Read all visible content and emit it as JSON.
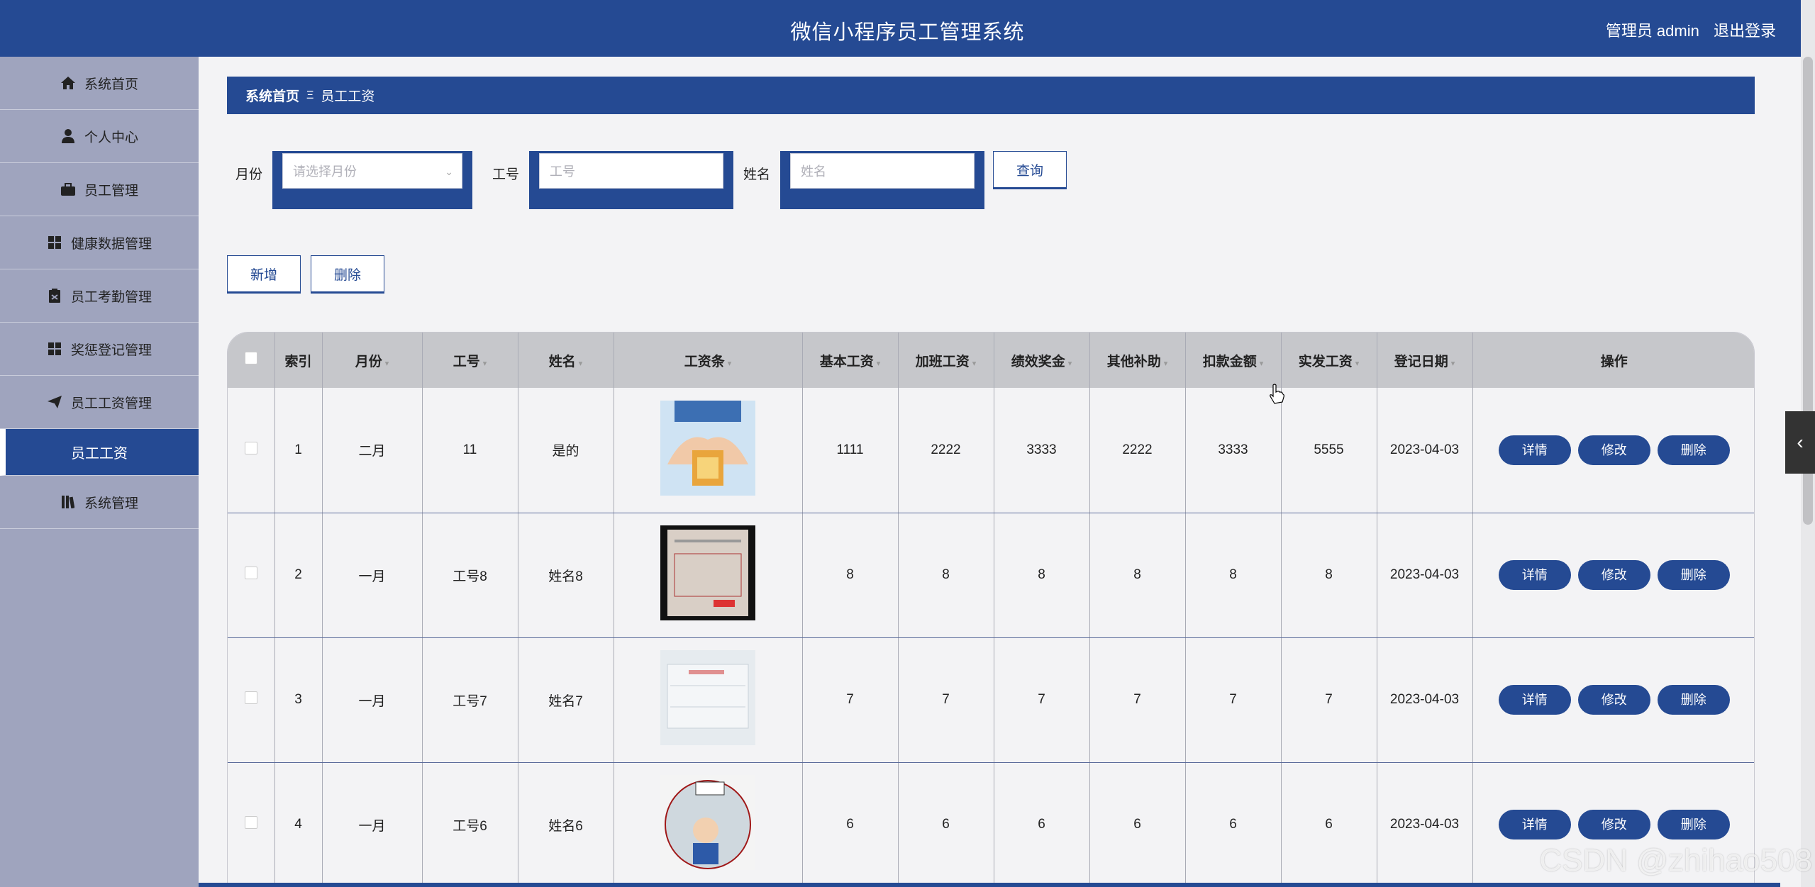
{
  "header": {
    "title": "微信小程序员工管理系统",
    "user_label": "管理员 admin",
    "logout": "退出登录"
  },
  "sidebar": {
    "items": [
      {
        "label": "系统首页",
        "icon": "home-icon"
      },
      {
        "label": "个人中心",
        "icon": "user-icon"
      },
      {
        "label": "员工管理",
        "icon": "briefcase-icon"
      },
      {
        "label": "健康数据管理",
        "icon": "grid-icon"
      },
      {
        "label": "员工考勤管理",
        "icon": "clipboard-icon"
      },
      {
        "label": "奖惩登记管理",
        "icon": "grid-icon"
      },
      {
        "label": "员工工资管理",
        "icon": "send-icon"
      },
      {
        "label": "员工工资",
        "icon": ""
      },
      {
        "label": "系统管理",
        "icon": "library-icon"
      }
    ]
  },
  "breadcrumb": {
    "home": "系统首页",
    "separator": "Ξ",
    "current": "员工工资"
  },
  "search": {
    "month_label": "月份",
    "month_placeholder": "请选择月份",
    "id_label": "工号",
    "id_placeholder": "工号",
    "name_label": "姓名",
    "name_placeholder": "姓名",
    "query": "查询"
  },
  "actions": {
    "add": "新增",
    "delete": "删除"
  },
  "table": {
    "headers": [
      "索引",
      "月份",
      "工号",
      "姓名",
      "工资条",
      "基本工资",
      "加班工资",
      "绩效奖金",
      "其他补助",
      "扣款金额",
      "实发工资",
      "登记日期",
      "操作"
    ],
    "rows": [
      {
        "index": "1",
        "month": "二月",
        "id": "11",
        "name": "是的",
        "base": "1111",
        "overtime": "2222",
        "bonus": "3333",
        "subsidy": "2222",
        "deduction": "3333",
        "net": "5555",
        "date": "2023-04-03"
      },
      {
        "index": "2",
        "month": "一月",
        "id": "工号8",
        "name": "姓名8",
        "base": "8",
        "overtime": "8",
        "bonus": "8",
        "subsidy": "8",
        "deduction": "8",
        "net": "8",
        "date": "2023-04-03"
      },
      {
        "index": "3",
        "month": "一月",
        "id": "工号7",
        "name": "姓名7",
        "base": "7",
        "overtime": "7",
        "bonus": "7",
        "subsidy": "7",
        "deduction": "7",
        "net": "7",
        "date": "2023-04-03"
      },
      {
        "index": "4",
        "month": "一月",
        "id": "工号6",
        "name": "姓名6",
        "base": "6",
        "overtime": "6",
        "bonus": "6",
        "subsidy": "6",
        "deduction": "6",
        "net": "6",
        "date": "2023-04-03"
      }
    ],
    "row_actions": {
      "detail": "详情",
      "edit": "修改",
      "delete": "删除"
    }
  },
  "watermark": "CSDN @zhihao508",
  "colors": {
    "primary": "#254a93",
    "sidebar": "#9fa4be",
    "header_row": "#c6c7cb"
  }
}
